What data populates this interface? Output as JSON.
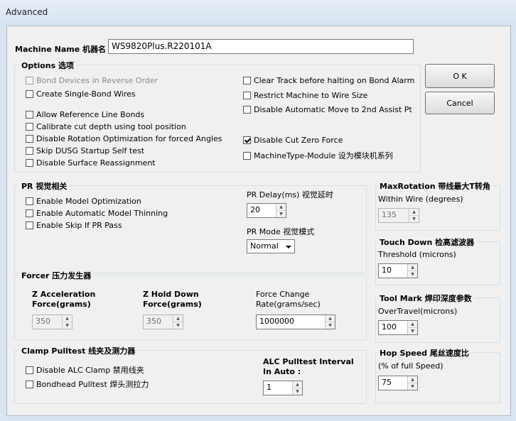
{
  "window": {
    "title": "Advanced"
  },
  "machine": {
    "label": "Machine Name 机器名",
    "value": "WS9820Plus.R220101A"
  },
  "buttons": {
    "ok": "O K",
    "cancel": "Cancel"
  },
  "options": {
    "legend": "Options 选项",
    "left": [
      {
        "label": "Bond Devices in Reverse Order",
        "checked": false,
        "disabled": true
      },
      {
        "label": "Create Single-Bond Wires",
        "checked": false,
        "disabled": false
      },
      {
        "label": "Allow Reference Line Bonds",
        "checked": false,
        "disabled": false
      },
      {
        "label": "Calibrate cut depth using tool position",
        "checked": false,
        "disabled": false
      },
      {
        "label": "Disable Rotation Optimization for forced Angles",
        "checked": false,
        "disabled": false
      },
      {
        "label": "Skip DUSG Startup Self test",
        "checked": false,
        "disabled": false
      },
      {
        "label": "Disable Surface Reassignment",
        "checked": false,
        "disabled": false
      }
    ],
    "right": [
      {
        "label": "Clear Track before halting on Bond Alarm",
        "checked": false
      },
      {
        "label": "Restrict Machine to Wire Size",
        "checked": false
      },
      {
        "label": "Disable Automatic Move to 2nd Assist Pt",
        "checked": false
      },
      {
        "label": "Disable Cut Zero Force",
        "checked": true
      },
      {
        "label": "MachineType-Module 设为模块机系列",
        "checked": false
      }
    ]
  },
  "pr": {
    "legend": "PR 视觉相关",
    "checks": [
      {
        "label": "Enable Model Optimization",
        "checked": false
      },
      {
        "label": "Enable Automatic Model Thinning",
        "checked": false
      },
      {
        "label": "Enable Skip If PR Pass",
        "checked": false
      }
    ],
    "delay_label": "PR Delay(ms) 视觉延时",
    "delay_value": "20",
    "mode_label": "PR Mode 视觉模式",
    "mode_value": "Normal"
  },
  "max_rotation": {
    "legend": "MaxRotation 带线最大T转角",
    "label": "Within Wire (degrees)",
    "value": "135"
  },
  "touch_down": {
    "legend": "Touch Down 检高滤波器",
    "label": "Threshold (microns)",
    "value": "10"
  },
  "tool_mark": {
    "legend": "Tool Mark 焊印深度参数",
    "label": "OverTravel(microns)",
    "value": "100"
  },
  "hop_speed": {
    "legend": "Hop Speed 尾丝速度比",
    "label": "(% of full Speed)",
    "value": "75"
  },
  "forcer": {
    "legend": "Forcer 压力发生器",
    "z_accel_label_1": "Z Acceleration",
    "z_accel_label_2": "Force(grams)",
    "z_accel_value": "350",
    "z_hold_label_1": "Z Hold Down",
    "z_hold_label_2": "Force(grams)",
    "z_hold_value": "350",
    "rate_label_1": "Force Change",
    "rate_label_2": "Rate(grams/sec)",
    "rate_value": "1000000"
  },
  "clamp": {
    "legend": "Clamp  Pulltest 线夹及测力器",
    "checks": [
      {
        "label": "Disable ALC Clamp 禁用线夹",
        "checked": false
      },
      {
        "label": "Bondhead Pulltest 焊头测拉力",
        "checked": false
      }
    ],
    "alc_label_1": "ALC Pulltest Interval",
    "alc_label_2": "In Auto :",
    "alc_value": "1"
  }
}
